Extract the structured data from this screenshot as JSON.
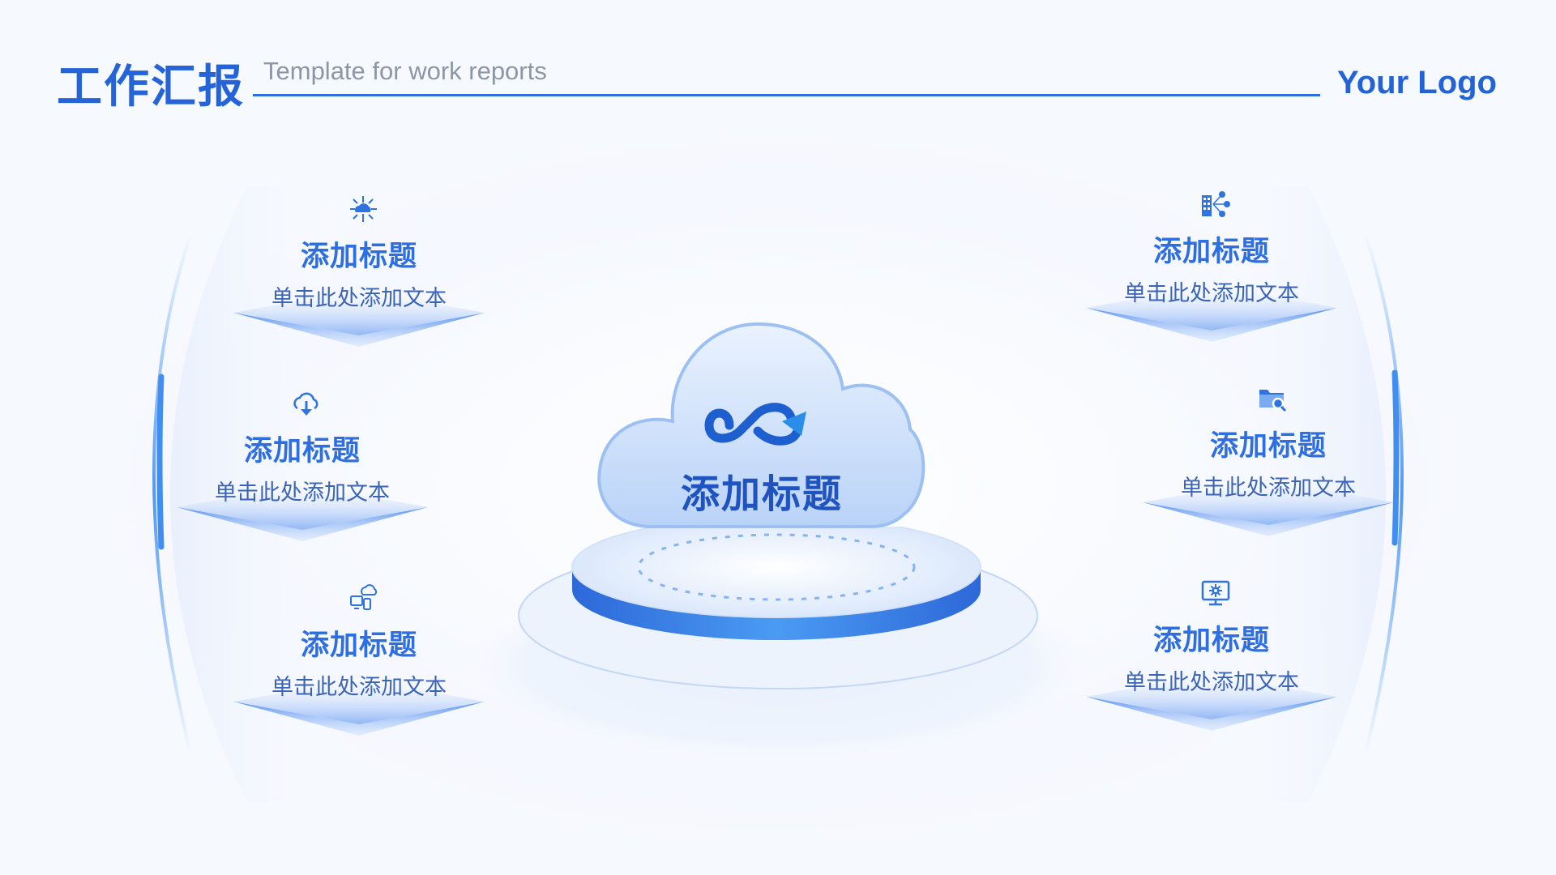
{
  "header": {
    "title_cn": "工作汇报",
    "title_en": "Template for work reports",
    "logo": "Your Logo"
  },
  "center": {
    "title": "添加标题",
    "icon": "infinity-cycle-icon"
  },
  "items": [
    {
      "title": "添加标题",
      "desc": "单击此处添加文本",
      "icon": "network-cloud-icon"
    },
    {
      "title": "添加标题",
      "desc": "单击此处添加文本",
      "icon": "cloud-download-icon"
    },
    {
      "title": "添加标题",
      "desc": "单击此处添加文本",
      "icon": "cloud-devices-icon"
    },
    {
      "title": "添加标题",
      "desc": "单击此处添加文本",
      "icon": "building-network-icon"
    },
    {
      "title": "添加标题",
      "desc": "单击此处添加文本",
      "icon": "folder-search-icon"
    },
    {
      "title": "添加标题",
      "desc": "单击此处添加文本",
      "icon": "monitor-settings-icon"
    }
  ],
  "colors": {
    "primary": "#2563d8",
    "accent": "#3f8ef0",
    "text_desc": "#3b63b8",
    "background": "#f6f9fe"
  }
}
